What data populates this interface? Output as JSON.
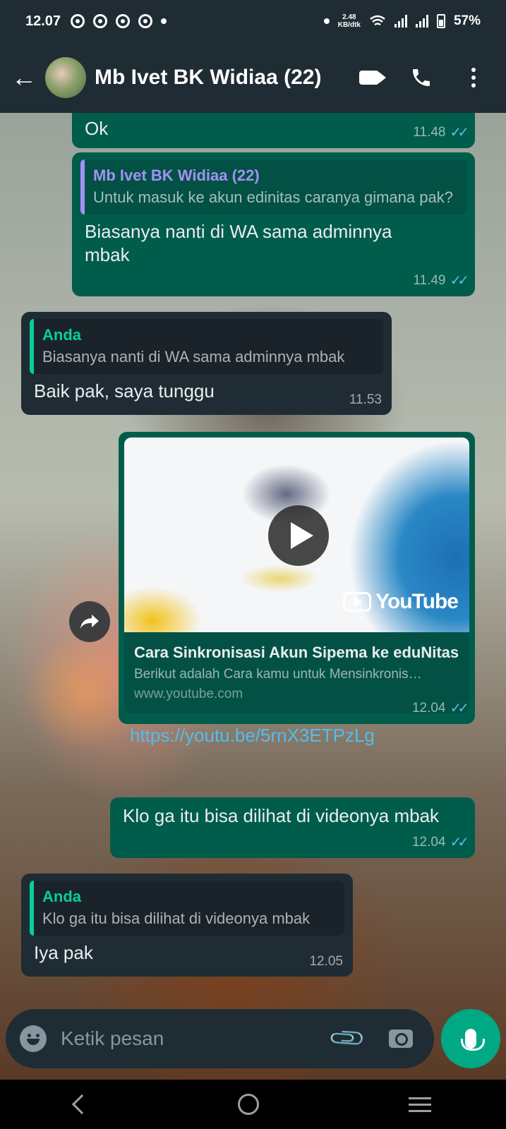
{
  "status_bar": {
    "time": "12.07",
    "speed_value": "2.48",
    "speed_unit": "KB/dtk",
    "battery": "57%"
  },
  "header": {
    "title": "Mb Ivet BK Widiaa (22)"
  },
  "messages": [
    {
      "text": "Ok",
      "time": "11.48"
    },
    {
      "quote_author": "Mb Ivet BK Widiaa (22)",
      "quote_text": "Untuk masuk ke akun edinitas caranya gimana pak?",
      "text": "Biasanya nanti di WA sama adminnya mbak",
      "time": "11.49"
    },
    {
      "quote_author": "Anda",
      "quote_text": "Biasanya nanti di WA sama adminnya mbak",
      "text": "Baik pak, saya tunggu",
      "time": "11.53"
    },
    {
      "preview_title": "Cara Sinkronisasi Akun Sipema ke eduNitas",
      "preview_desc": "Berikut adalah Cara kamu untuk Mensinkronis…",
      "preview_domain": "www.youtube.com",
      "youtube_logo_text": "YouTube",
      "link": "https://youtu.be/5rnX3ETPzLg",
      "time": "12.04"
    },
    {
      "text": "Klo ga itu bisa dilihat di videonya mbak",
      "time": "12.04"
    },
    {
      "quote_author": "Anda",
      "quote_text": "Klo ga itu bisa dilihat di videonya mbak",
      "text": "Iya pak",
      "time": "12.05"
    }
  ],
  "input": {
    "placeholder": "Ketik pesan"
  },
  "icons": {
    "back": "arrow-left-icon",
    "video": "video-camera-icon",
    "call": "phone-icon",
    "menu": "more-vertical-icon",
    "emoji": "emoji-icon",
    "attach": "paperclip-icon",
    "camera": "camera-icon",
    "mic": "microphone-icon",
    "forward": "forward-icon"
  },
  "colors": {
    "outgoing_bubble": "#005c4b",
    "incoming_bubble": "#1f2c34",
    "accent": "#00a884",
    "read_ticks": "#53bdeb"
  }
}
